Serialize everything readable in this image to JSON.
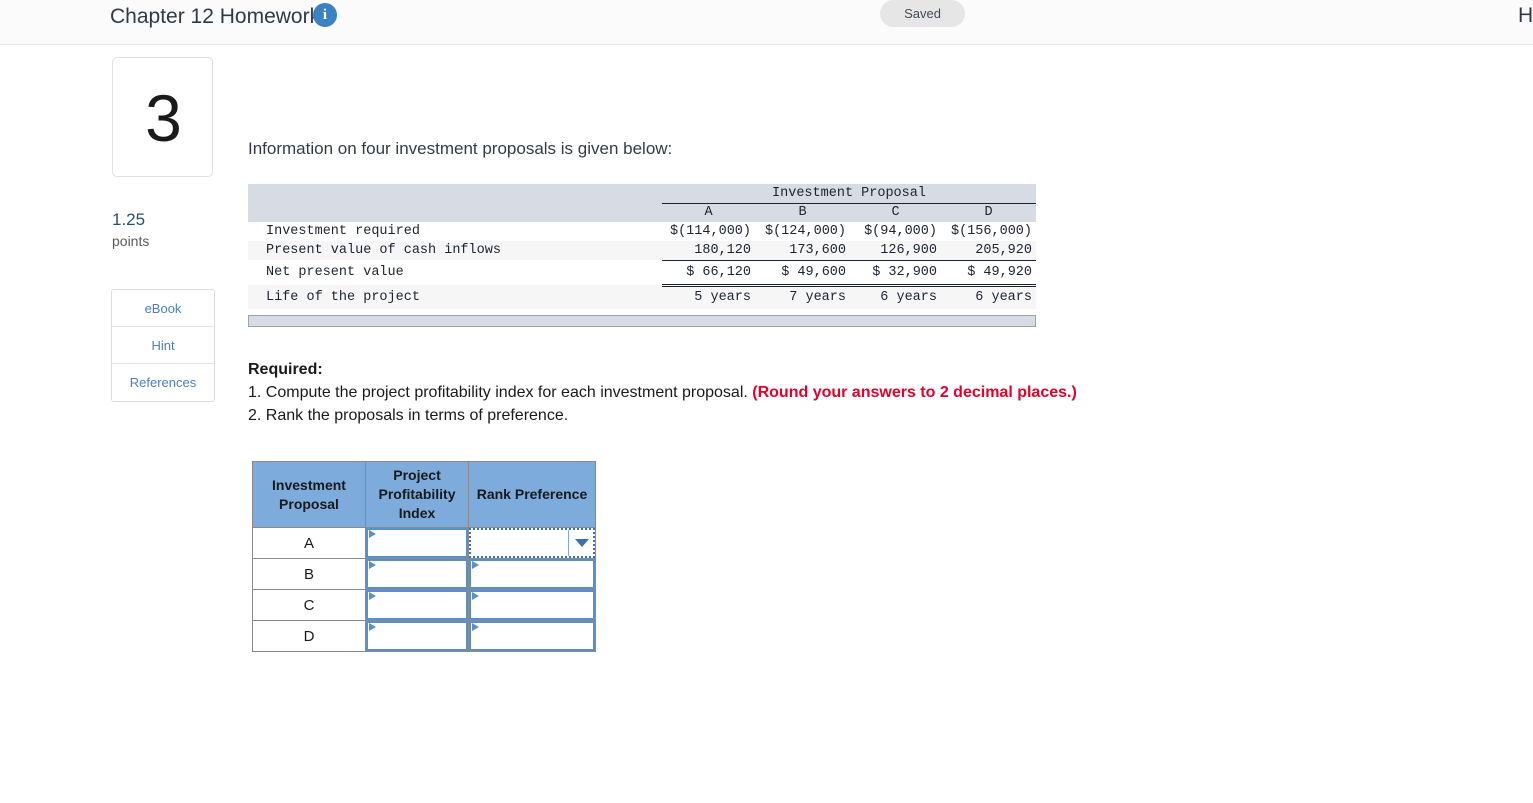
{
  "topbar": {
    "title": "Chapter 12 Homework",
    "info_icon": "info-icon",
    "saved_label": "Saved",
    "right_cut_label": "H"
  },
  "rail": {
    "question_number": "3",
    "points_value": "1.25",
    "points_label": "points",
    "buttons": [
      {
        "label": "eBook",
        "name": "ebook"
      },
      {
        "label": "Hint",
        "name": "hint"
      },
      {
        "label": "References",
        "name": "references"
      }
    ]
  },
  "main": {
    "intro": "Information on four investment proposals is given below:",
    "required_heading": "Required:",
    "requirement_1_text": "1. Compute the project profitability index for each investment proposal. ",
    "requirement_1_warning": "(Round your answers to 2 decimal places.)",
    "requirement_2": "2. Rank the proposals in terms of preference."
  },
  "data_table": {
    "group_header": "Investment Proposal",
    "columns": [
      "A",
      "B",
      "C",
      "D"
    ],
    "rows": [
      {
        "label": "Investment required",
        "values": [
          "$(114,000)",
          "$(124,000)",
          "$(94,000)",
          "$(156,000)"
        ]
      },
      {
        "label": "Present value of cash inflows",
        "values": [
          "180,120",
          "173,600",
          "126,900",
          "205,920"
        ]
      },
      {
        "label": "Net present value",
        "values": [
          "$  66,120",
          "$  49,600",
          "$ 32,900",
          "$  49,920"
        ]
      },
      {
        "label": "Life of the project",
        "values": [
          "5 years",
          "7 years",
          "6 years",
          "6 years"
        ]
      }
    ]
  },
  "answer_table": {
    "headers": [
      "Investment Proposal",
      "Project Profitability Index",
      "Rank Preference"
    ],
    "rows": [
      {
        "proposal": "A",
        "ppi": "",
        "rank": ""
      },
      {
        "proposal": "B",
        "ppi": "",
        "rank": ""
      },
      {
        "proposal": "C",
        "ppi": "",
        "rank": ""
      },
      {
        "proposal": "D",
        "ppi": "",
        "rank": ""
      }
    ]
  },
  "colors": {
    "header_blue": "#7cabdc",
    "table_header_gray": "#d6dbe4",
    "accent_blue": "#3b82c4",
    "warning_red": "#e4002b",
    "input_border": "#5b8fc9"
  }
}
